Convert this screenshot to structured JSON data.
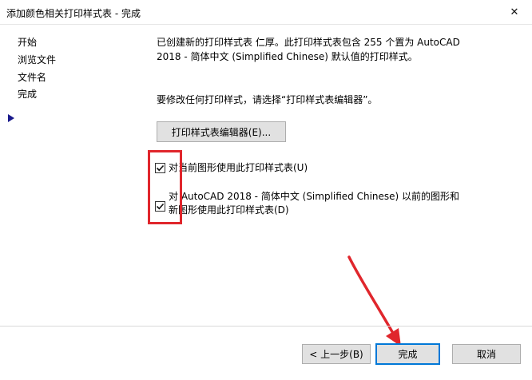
{
  "window": {
    "title": "添加颜色相关打印样式表 - 完成",
    "close_glyph": "✕"
  },
  "nav": {
    "items": [
      "开始",
      "浏览文件",
      "文件名",
      "完成"
    ],
    "current": "完成"
  },
  "content": {
    "info_line1": "已创建新的打印样式表 仁厚。此打印样式表包含 255 个置为 AutoCAD",
    "info_line2": "2018 - 简体中文 (Simplified Chinese) 默认值的打印样式。",
    "modify_hint": "要修改任何打印样式，请选择“打印样式表编辑器”。",
    "editor_button": "打印样式表编辑器(E)...",
    "checkbox1": {
      "label": "对当前图形使用此打印样式表(U)",
      "checked": true
    },
    "checkbox2": {
      "label_line1": "对 AutoCAD 2018 - 简体中文 (Simplified Chinese) 以前的图形和",
      "label_line2": "新图形使用此打印样式表(D)",
      "checked": true
    }
  },
  "footer": {
    "back_button": "< 上一步(B)",
    "finish_button": "完成",
    "cancel_button": "取消"
  },
  "annotations": {
    "highlight_color": "#e0262c"
  }
}
